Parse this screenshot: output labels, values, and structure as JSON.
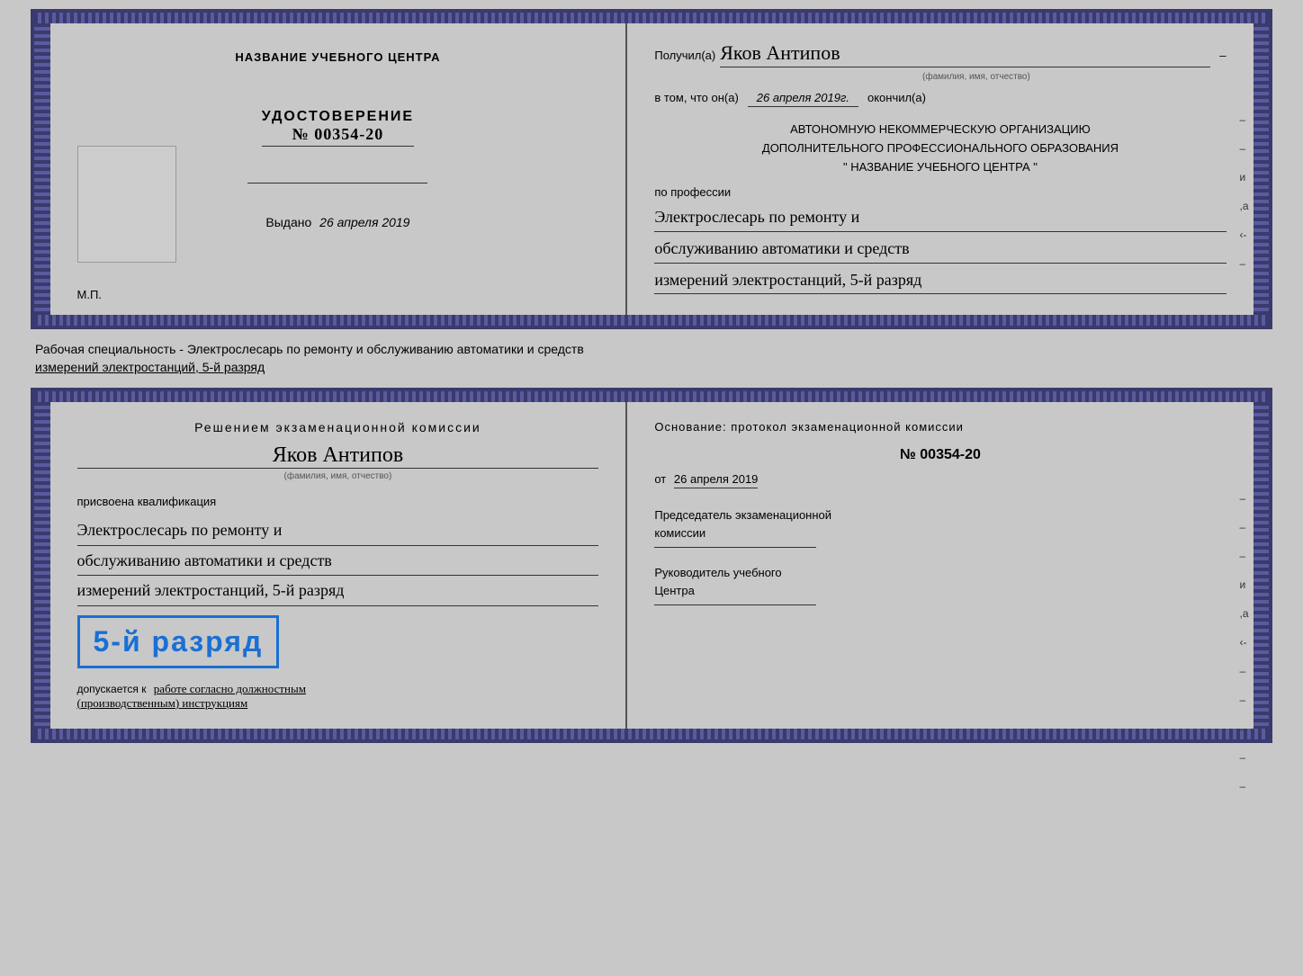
{
  "top_booklet": {
    "left": {
      "center_title": "НАЗВАНИЕ УЧЕБНОГО ЦЕНТРА",
      "cert_label": "УДОСТОВЕРЕНИЕ",
      "cert_number": "№ 00354-20",
      "issued_prefix": "Выдано",
      "issued_date": "26 апреля 2019",
      "mp_label": "М.П."
    },
    "right": {
      "recipient_prefix": "Получил(а)",
      "recipient_name": "Яков Антипов",
      "recipient_sublabel": "(фамилия, имя, отчество)",
      "in_that_prefix": "в том, что он(а)",
      "in_that_date": "26 апреля 2019г.",
      "in_that_suffix": "окончил(а)",
      "org_line1": "АВТОНОМНУЮ НЕКОММЕРЧЕСКУЮ ОРГАНИЗАЦИЮ",
      "org_line2": "ДОПОЛНИТЕЛЬНОГО ПРОФЕССИОНАЛЬНОГО ОБРАЗОВАНИЯ",
      "org_line3": "\"  НАЗВАНИЕ УЧЕБНОГО ЦЕНТРА  \"",
      "profession_label": "по профессии",
      "profession_line1": "Электрослесарь по ремонту и",
      "profession_line2": "обслуживанию автоматики и средств",
      "profession_line3": "измерений электростанций, 5-й разряд"
    }
  },
  "between_text": {
    "line1": "Рабочая специальность - Электрослесарь по ремонту и обслуживанию автоматики и средств",
    "line2": "измерений электростанций, 5-й разряд"
  },
  "bottom_booklet": {
    "left": {
      "decision_title": "Решением  экзаменационной  комиссии",
      "person_name": "Яков Антипов",
      "fio_label": "(фамилия, имя, отчество)",
      "qualification_label": "присвоена квалификация",
      "qual_line1": "Электрослесарь по ремонту и",
      "qual_line2": "обслуживанию автоматики и средств",
      "qual_line3": "измерений электростанций, 5-й разряд",
      "grade_text": "5-й разряд",
      "admitted_prefix": "допускается к",
      "admitted_cursive": "работе согласно должностным",
      "admitted_cursive2": "(производственным) инструкциям"
    },
    "right": {
      "basis_title": "Основание:  протокол  экзаменационной  комиссии",
      "protocol_number": "№  00354-20",
      "from_prefix": "от",
      "from_date": "26 апреля 2019",
      "chair_label": "Председатель экзаменационной",
      "chair_label2": "комиссии",
      "director_label": "Руководитель учебного",
      "director_label2": "Центра"
    }
  }
}
